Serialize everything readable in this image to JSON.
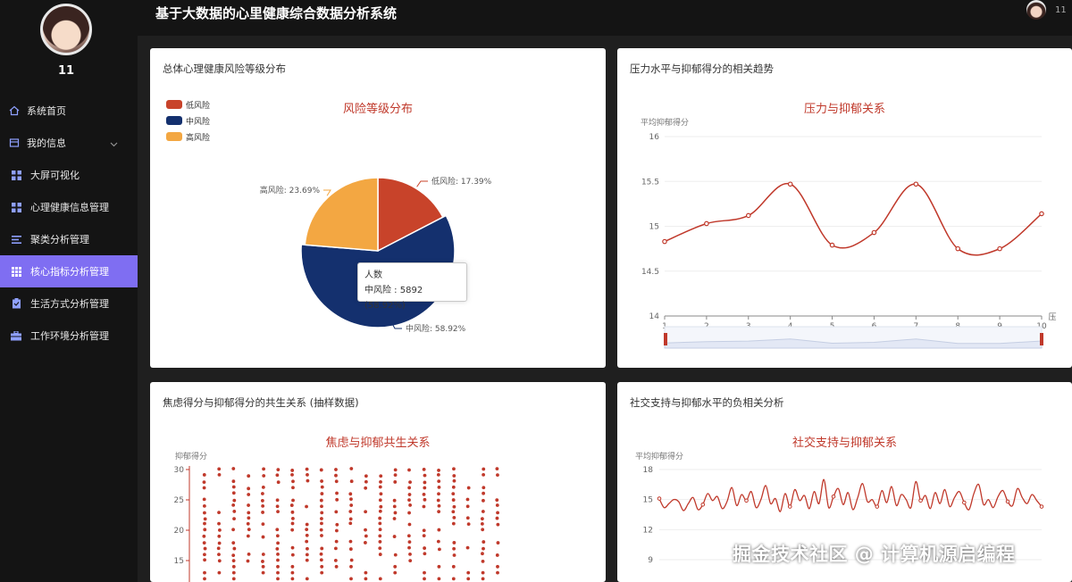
{
  "app": {
    "title": "基于大数据的心里健康综合数据分析系统"
  },
  "user": {
    "name": "11",
    "top_name": "11"
  },
  "sidebar": {
    "items": [
      {
        "label": "系统首页",
        "icon": "home-icon"
      },
      {
        "label": "我的信息",
        "icon": "profile-icon"
      },
      {
        "label": "大屏可视化",
        "icon": "grid-icon"
      },
      {
        "label": "心理健康信息管理",
        "icon": "grid-icon"
      },
      {
        "label": "聚类分析管理",
        "icon": "list-icon"
      },
      {
        "label": "核心指标分析管理",
        "icon": "grid-icon",
        "active": true
      },
      {
        "label": "生活方式分析管理",
        "icon": "clipboard-icon"
      },
      {
        "label": "工作环境分析管理",
        "icon": "briefcase-icon"
      }
    ]
  },
  "colors": {
    "accent": "#7f6ef2",
    "chart_red": "#c0392b",
    "low": "#c8432a",
    "mid": "#14306e",
    "high": "#f3a742"
  },
  "cards": {
    "risk": {
      "title": "总体心理健康风险等级分布",
      "tooltip": {
        "name": "人数",
        "line": "中风险 : 5892 (58.92%)"
      }
    },
    "stress": {
      "title": "压力水平与抑郁得分的相关趋势"
    },
    "anxiety": {
      "title": "焦虑得分与抑郁得分的共生关系 (抽样数据)"
    },
    "social": {
      "title": "社交支持与抑郁水平的负相关分析"
    }
  },
  "chart_data": [
    {
      "type": "pie",
      "title": "风险等级分布",
      "legend": [
        "低风险",
        "中风险",
        "高风险"
      ],
      "slices": [
        {
          "name": "低风险",
          "percent": 17.39,
          "label": "低风险: 17.39%"
        },
        {
          "name": "中风险",
          "value": 5892,
          "percent": 58.92,
          "label": "中风险: 58.92%"
        },
        {
          "name": "高风险",
          "percent": 23.69,
          "label": "高风险: 23.69%"
        }
      ],
      "legend_position": "top-left"
    },
    {
      "type": "line",
      "title": "压力与抑郁关系",
      "ylabel": "平均抑郁得分",
      "xlabel": "压",
      "x": [
        1,
        2,
        3,
        4,
        5,
        6,
        7,
        8,
        9,
        10
      ],
      "y": [
        14.83,
        15.03,
        15.12,
        15.47,
        14.79,
        14.93,
        15.47,
        14.75,
        14.75,
        15.14
      ],
      "ylim": [
        14,
        16
      ],
      "yticks": [
        "16",
        "15.5",
        "15",
        "14.5",
        "14"
      ],
      "datazoom": true
    },
    {
      "type": "scatter",
      "title": "焦虑与抑郁共生关系",
      "ylabel": "抑郁得分",
      "yticks": [
        "30",
        "25",
        "20",
        "15"
      ],
      "ylim": [
        15,
        30
      ],
      "x": [
        1,
        2,
        3,
        4,
        5,
        6,
        7,
        8,
        9,
        10,
        11,
        12,
        13,
        14,
        15,
        16,
        17,
        18,
        19,
        20,
        21
      ],
      "y_range": [
        15,
        30
      ]
    },
    {
      "type": "line",
      "title": "社交支持与抑郁关系",
      "ylabel": "平均抑郁得分",
      "yticks": [
        "18",
        "15",
        "12",
        "9"
      ],
      "ylim": [
        9,
        18
      ],
      "y": [
        15.1,
        14.2,
        14.6,
        15.0,
        14.8,
        13.9,
        14.6,
        15.2,
        14.0,
        14.5,
        15.6,
        14.9,
        15.3,
        14.1,
        14.8,
        16.2,
        14.4,
        15.5,
        14.9,
        15.8,
        14.2,
        15.0,
        16.4,
        14.6,
        15.1,
        13.8,
        15.6,
        14.3,
        16.0,
        14.9,
        15.4,
        14.1,
        15.8,
        14.6,
        17.0,
        14.2,
        15.3,
        16.1,
        14.5,
        15.7,
        14.0,
        15.2,
        16.6,
        14.8,
        15.0,
        14.3,
        15.9,
        14.7,
        16.3,
        14.4,
        15.5,
        15.0,
        14.2,
        16.8,
        14.9,
        15.4,
        14.1,
        15.7,
        14.6,
        16.0,
        14.3,
        15.2,
        15.8,
        14.7,
        14.0,
        15.6,
        16.5,
        14.5,
        15.0,
        14.2,
        15.3,
        15.9,
        14.8,
        14.4,
        16.1,
        15.2,
        14.6,
        15.5,
        14.9,
        14.3
      ]
    }
  ],
  "watermark": "掘金技术社区 @ 计算机源启编程"
}
